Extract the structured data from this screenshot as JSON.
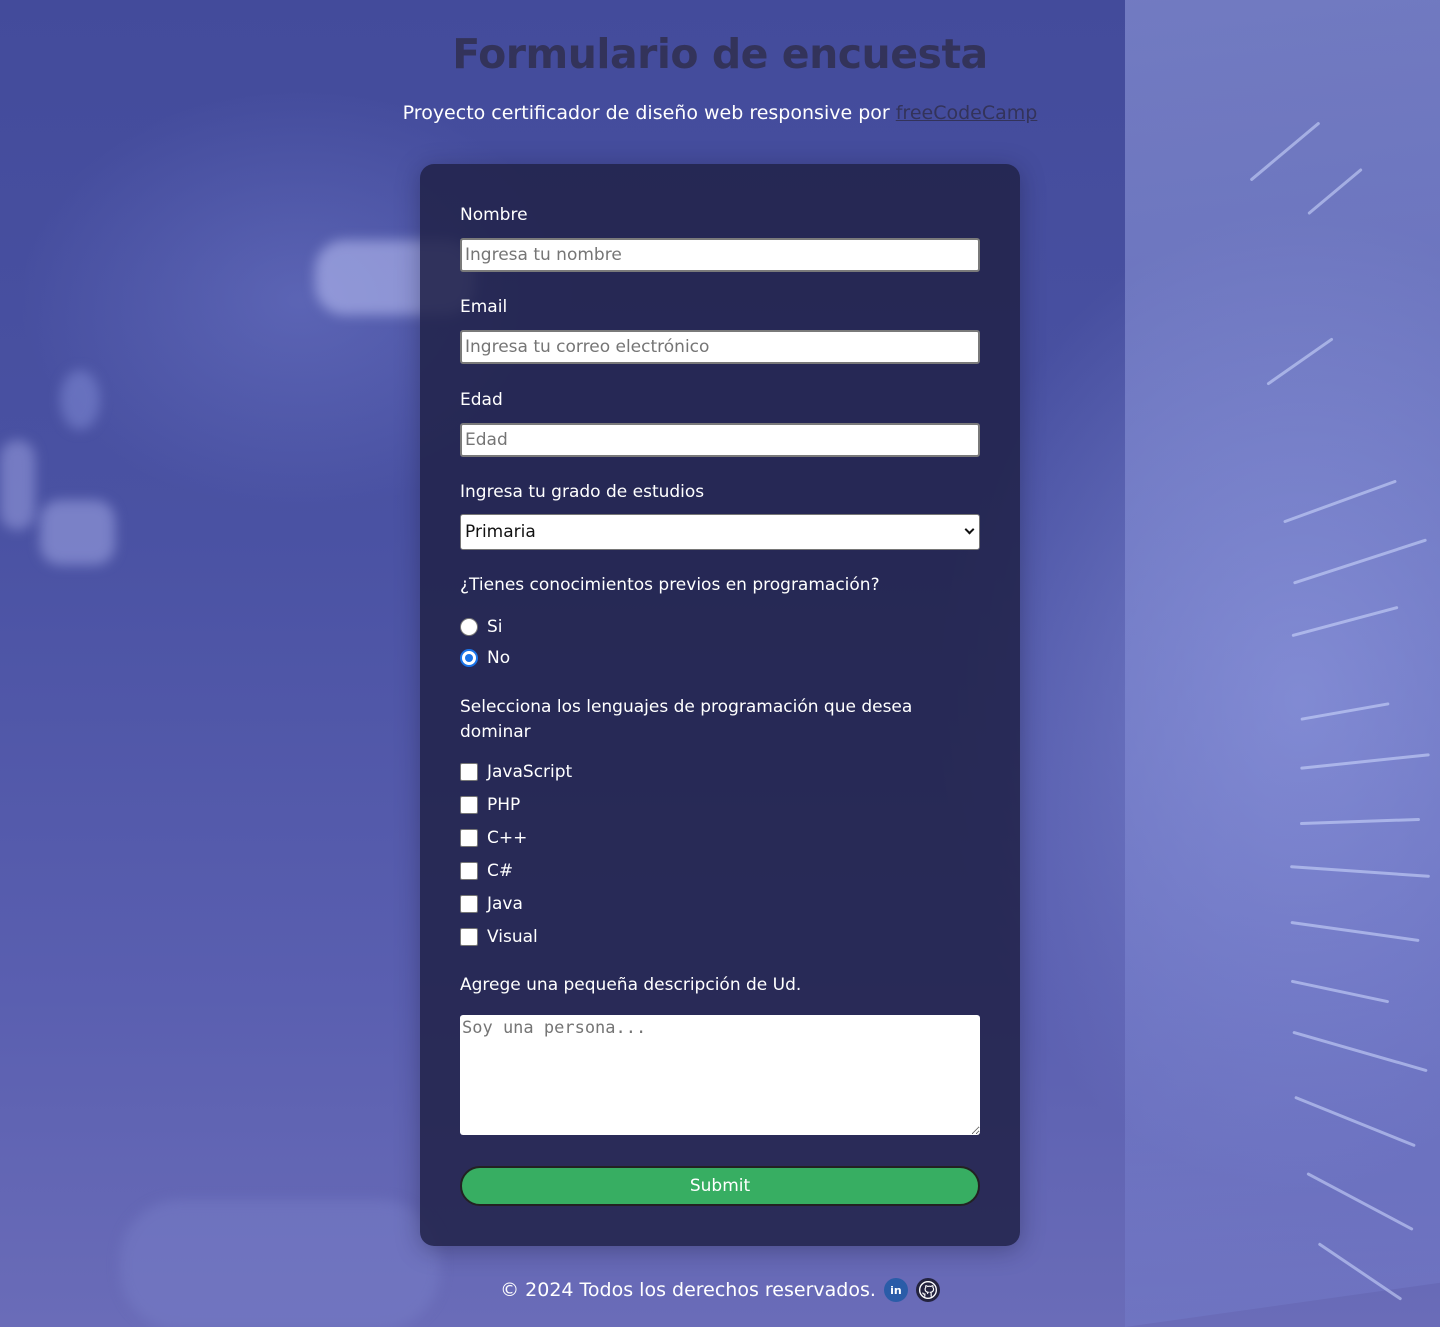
{
  "header": {
    "title": "Formulario de encuesta",
    "subtitle_prefix": "Proyecto certificador de diseño web responsive por",
    "subtitle_link": "freeCodeCamp"
  },
  "form": {
    "name": {
      "label": "Nombre",
      "placeholder": "Ingresa tu nombre"
    },
    "email": {
      "label": "Email",
      "placeholder": "Ingresa tu correo electrónico"
    },
    "age": {
      "label": "Edad",
      "placeholder": "Edad"
    },
    "education": {
      "label": "Ingresa tu grado de estudios",
      "selected": "Primaria"
    },
    "experience": {
      "question": "¿Tienes conocimientos previos en programación?",
      "options": [
        {
          "label": "Si",
          "checked": false
        },
        {
          "label": "No",
          "checked": true
        }
      ]
    },
    "languages": {
      "question": "Selecciona los lenguajes de programación que desea dominar",
      "options": [
        "JavaScript",
        "PHP",
        "C++",
        "C#",
        "Java",
        "Visual"
      ]
    },
    "description": {
      "label": "Agrege una pequeña descripción de Ud.",
      "placeholder": "Soy una persona..."
    },
    "submit_label": "Submit"
  },
  "footer": {
    "copyright": "© 2024 Todos los derechos reservados.",
    "linkedin_text": "in",
    "icons": [
      "linkedin-icon",
      "github-icon"
    ]
  },
  "colors": {
    "accent_radio": "#1a73e8",
    "submit_bg": "#37ae62",
    "card_bg": "#212248"
  }
}
